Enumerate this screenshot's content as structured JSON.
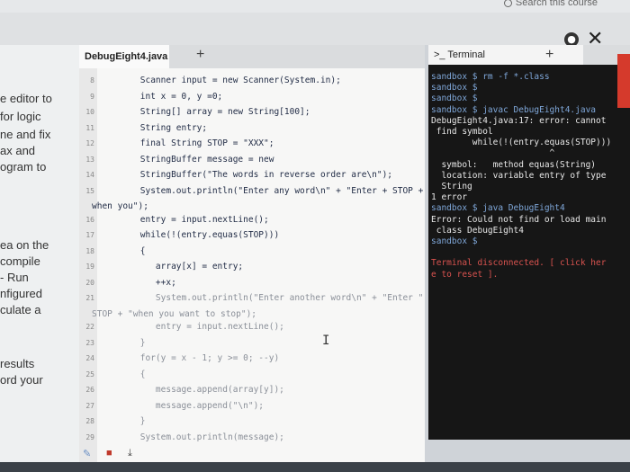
{
  "top": {
    "search_text": "Search this course"
  },
  "left_panel": {
    "lines": [
      "e editor to",
      "for logic",
      "ne and fix",
      "ax and",
      "ogram to",
      "ea on the",
      "compile",
      "- Run",
      "nfigured",
      "culate a",
      "results",
      "ord your"
    ]
  },
  "editor": {
    "tab_label": "DebugEight4.java",
    "plus": "+",
    "lines": [
      {
        "n": "8",
        "text": "        Scanner input = new Scanner(System.in);"
      },
      {
        "n": "9",
        "text": "        int x = 0, y =0;"
      },
      {
        "n": "10",
        "text": "        String[] array = new String[100];"
      },
      {
        "n": "11",
        "text": "        String entry;"
      },
      {
        "n": "12",
        "text": "        final String STOP = \"XXX\";"
      },
      {
        "n": "13",
        "text": "        StringBuffer message = new"
      },
      {
        "n": "14",
        "text": "        StringBuffer(\"The words in reverse order are\\n\");"
      },
      {
        "n": "15",
        "text": "        System.out.println(\"Enter any word\\n\" + \"Enter + STOP +"
      },
      {
        "n": "",
        "text": "when you\");"
      },
      {
        "n": "16",
        "text": "        entry = input.nextLine();"
      },
      {
        "n": "17",
        "text": "        while(!(entry.equas(STOP)))"
      },
      {
        "n": "18",
        "text": "        {"
      },
      {
        "n": "19",
        "text": "           array[x] = entry;"
      },
      {
        "n": "20",
        "text": "           ++x;"
      },
      {
        "n": "21",
        "text": "           System.out.println(\"Enter another word\\n\" + \"Enter \" +"
      },
      {
        "n": "",
        "text": "STOP + \"when you want to stop\");"
      },
      {
        "n": "22",
        "text": "           entry = input.nextLine();"
      },
      {
        "n": "23",
        "text": "        }"
      },
      {
        "n": "24",
        "text": "        for(y = x - 1; y >= 0; --y)"
      },
      {
        "n": "25",
        "text": "        {"
      },
      {
        "n": "26",
        "text": "           message.append(array[y]);"
      },
      {
        "n": "27",
        "text": "           message.append(\"\\n\");"
      },
      {
        "n": "28",
        "text": "        }"
      },
      {
        "n": "29",
        "text": "        System.out.println(message);"
      }
    ]
  },
  "terminal": {
    "tab_label": ">_ Terminal",
    "plus": "+",
    "lines": [
      {
        "text": "sandbox $ rm -f *.class",
        "cls": "g"
      },
      {
        "text": "sandbox $",
        "cls": "g"
      },
      {
        "text": "sandbox $",
        "cls": "g"
      },
      {
        "text": "sandbox $ javac DebugEight4.java",
        "cls": "g"
      },
      {
        "text": "DebugEight4.java:17: error: cannot",
        "cls": ""
      },
      {
        "text": " find symbol",
        "cls": ""
      },
      {
        "text": "        while(!(entry.equas(STOP)))",
        "cls": ""
      },
      {
        "text": "                       ^",
        "cls": ""
      },
      {
        "text": "  symbol:   method equas(String)",
        "cls": ""
      },
      {
        "text": "  location: variable entry of type",
        "cls": ""
      },
      {
        "text": "  String",
        "cls": ""
      },
      {
        "text": "1 error",
        "cls": ""
      },
      {
        "text": "sandbox $ java DebugEight4",
        "cls": "g"
      },
      {
        "text": "Error: Could not find or load main",
        "cls": ""
      },
      {
        "text": " class DebugEight4",
        "cls": ""
      },
      {
        "text": "sandbox $",
        "cls": "g"
      },
      {
        "text": "",
        "cls": ""
      },
      {
        "text": "Terminal disconnected. [ click her",
        "cls": "r"
      },
      {
        "text": "e to reset ].",
        "cls": "r"
      }
    ]
  },
  "colors": {
    "terminal_bg": "#161616",
    "editor_bg": "#f7f7f6",
    "accent_red": "#d53a2c"
  }
}
